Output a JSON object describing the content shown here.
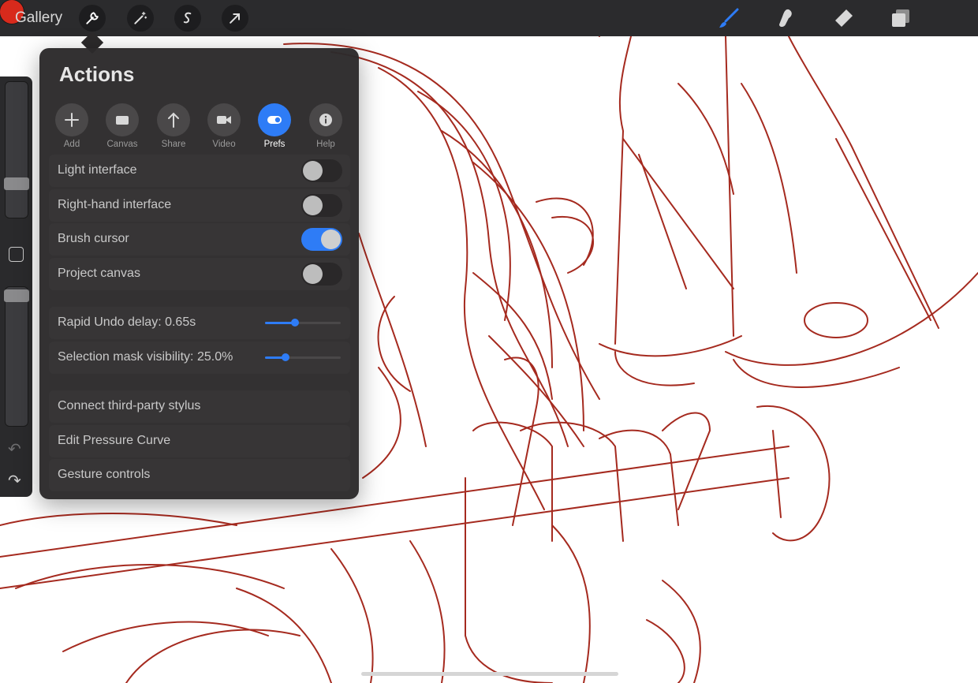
{
  "topbar": {
    "gallery_label": "Gallery",
    "tools": [
      "wrench-icon",
      "magic-wand-icon",
      "selection-icon",
      "transform-arrow-icon"
    ],
    "right_tools": [
      "brush-icon",
      "smudge-icon",
      "eraser-icon",
      "layers-icon"
    ],
    "current_color": "#d82a1c",
    "active_tool_color": "#2e7cf6"
  },
  "actions": {
    "title": "Actions",
    "tabs": [
      {
        "label": "Add",
        "icon": "plus-icon"
      },
      {
        "label": "Canvas",
        "icon": "canvas-icon"
      },
      {
        "label": "Share",
        "icon": "share-arrow-icon"
      },
      {
        "label": "Video",
        "icon": "video-camera-icon"
      },
      {
        "label": "Prefs",
        "icon": "toggle-icon",
        "active": true
      },
      {
        "label": "Help",
        "icon": "info-icon"
      }
    ],
    "toggles": [
      {
        "label": "Light interface",
        "on": false
      },
      {
        "label": "Right-hand interface",
        "on": false
      },
      {
        "label": "Brush cursor",
        "on": true
      },
      {
        "label": "Project canvas",
        "on": false
      }
    ],
    "sliders": [
      {
        "label": "Rapid Undo delay: 0.65s",
        "value_fraction": 0.4
      },
      {
        "label": "Selection mask visibility: 25.0%",
        "value_fraction": 0.27
      }
    ],
    "links": [
      {
        "label": "Connect third-party stylus"
      },
      {
        "label": "Edit Pressure Curve"
      },
      {
        "label": "Gesture controls"
      }
    ]
  },
  "sidebar": {
    "brush_size_fraction": 0.27,
    "brush_opacity_fraction": 0.05
  },
  "canvas": {
    "stroke_color": "#a52a1f"
  }
}
